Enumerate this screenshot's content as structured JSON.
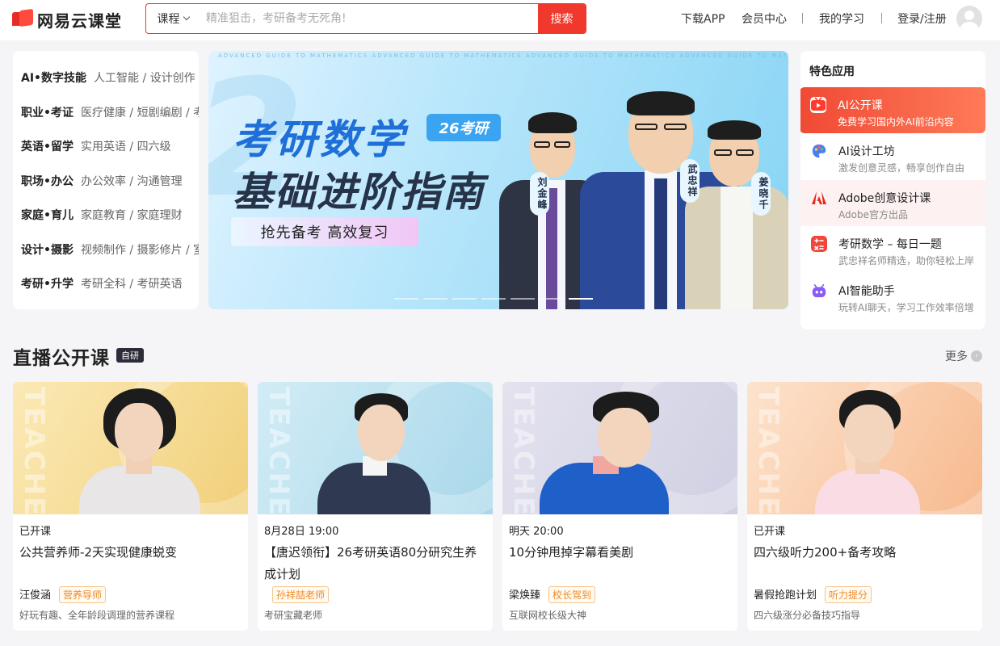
{
  "header": {
    "logo_text": "网易云课堂",
    "search": {
      "category": "课程",
      "placeholder": "精准狙击，考研备考无死角!",
      "button": "搜索"
    },
    "nav": {
      "download": "下载APP",
      "member": "会员中心",
      "my_learning": "我的学习",
      "login": "登录/注册"
    }
  },
  "categories": [
    {
      "name": "AI•数字技能",
      "sub": "人工智能 / 设计创作"
    },
    {
      "name": "职业•考证",
      "sub": "医疗健康 / 短剧编剧 / 考"
    },
    {
      "name": "英语•留学",
      "sub": "实用英语 / 四六级"
    },
    {
      "name": "职场•办公",
      "sub": "办公效率 / 沟通管理"
    },
    {
      "name": "家庭•育儿",
      "sub": "家庭教育 / 家庭理财"
    },
    {
      "name": "设计•摄影",
      "sub": "视频制作 / 摄影修片 / 室"
    },
    {
      "name": "考研•升学",
      "sub": "考研全科 / 考研英语"
    }
  ],
  "banner": {
    "strip": "ADVANCED GUIDE TO MATHEMATICS    ADVANCED GUIDE TO MATHEMATICS    ADVANCED GUIDE TO MATHEMATICS    ADVANCED GUIDE TO MATHEMATICS",
    "title_line1": "考研数学",
    "title_line2": "基础进阶指南",
    "badge": "26考研",
    "tagline": "抢先备考  高效复习",
    "teachers": [
      "刘金峰",
      "武忠祥",
      "姜晓千"
    ],
    "slide_count": 7,
    "active_slide": 7
  },
  "featured_apps": {
    "title": "特色应用",
    "items": [
      {
        "name": "AI公开课",
        "desc": "免费学习国内外AI前沿内容",
        "icon": "play-icon",
        "color": "#ff3b30"
      },
      {
        "name": "AI设计工坊",
        "desc": "激发创意灵感，畅享创作自由",
        "icon": "palette-icon",
        "color": "#4c7ef3"
      },
      {
        "name": "Adobe创意设计课",
        "desc": "Adobe官方出品",
        "icon": "adobe-icon",
        "color": "#e8271b"
      },
      {
        "name": "考研数学 – 每日一题",
        "desc": "武忠祥名师精选，助你轻松上岸",
        "icon": "calculator-icon",
        "color": "#f2463a"
      },
      {
        "name": "AI智能助手",
        "desc": "玩转AI聊天，学习工作效率倍增",
        "icon": "robot-icon",
        "color": "#8a5cf6"
      }
    ]
  },
  "live_section": {
    "title": "直播公开课",
    "badge": "自研",
    "more": "更多",
    "cards": [
      {
        "time": "已开课",
        "title": "公共营养师-2天实现健康蜕变",
        "teacher": "汪俊涵",
        "tag": "营养导师",
        "desc": "好玩有趣、全年龄段调理的营养课程",
        "watermark": "TEACHER"
      },
      {
        "time": "8月28日 19:00",
        "title": "【唐迟领衔】26考研英语80分研究生养成计划",
        "teacher": "",
        "tag": "孙祥喆老师",
        "desc": "考研宝藏老师",
        "watermark": "TEACHER"
      },
      {
        "time": "明天 20:00",
        "title": "10分钟甩掉字幕看美剧",
        "teacher": "梁焕臻",
        "tag": "校长驾到",
        "desc": "互联网校长级大神",
        "watermark": "TEACHER"
      },
      {
        "time": "已开课",
        "title": "四六级听力200+备考攻略",
        "teacher": "暑假抢跑计划",
        "tag": "听力提分",
        "desc": "四六级涨分必备技巧指导",
        "watermark": "TEACHER"
      }
    ]
  }
}
